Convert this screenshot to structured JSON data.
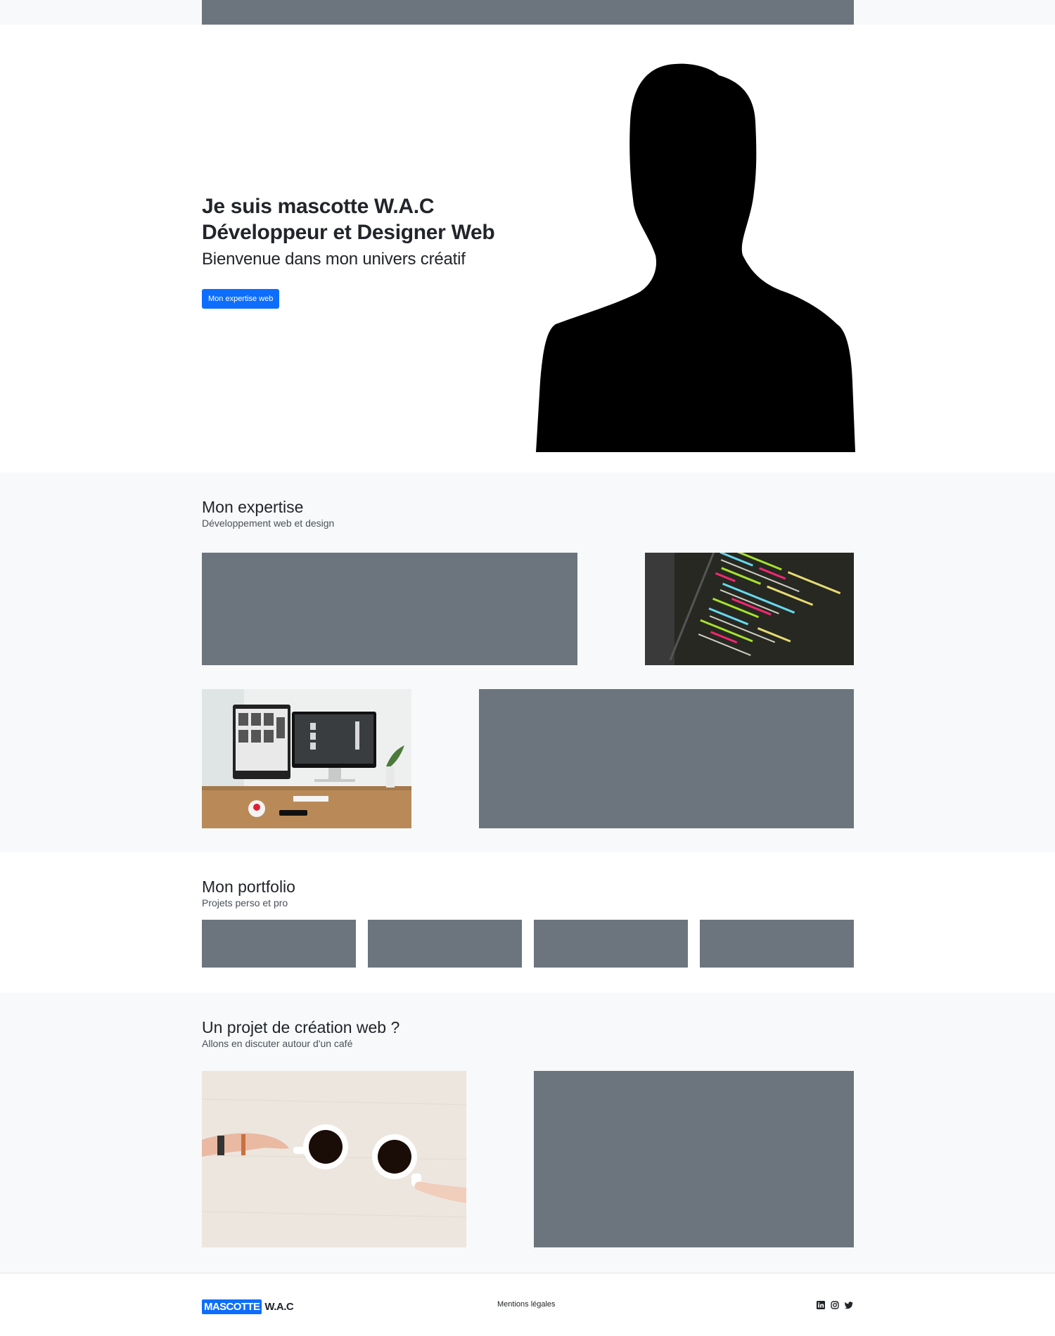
{
  "hero": {
    "title_line1": "Je suis mascotte W.A.C",
    "title_line2": "Développeur et Designer Web",
    "subtitle": "Bienvenue dans mon univers créatif",
    "cta_label": "Mon expertise web"
  },
  "expertise": {
    "title": "Mon expertise",
    "subtitle": "Développement web et design"
  },
  "portfolio": {
    "title": "Mon portfolio",
    "subtitle": "Projets perso et pro"
  },
  "contact": {
    "title": "Un projet de création web ?",
    "subtitle": "Allons en discuter autour d'un café"
  },
  "footer": {
    "logo_box": "MASCOTTE",
    "logo_text": "W.A.C",
    "legal_link": "Mentions légales",
    "social_icons": [
      "linkedin-icon",
      "instagram-icon",
      "twitter-icon"
    ]
  },
  "colors": {
    "primary": "#0d6efd",
    "placeholder": "#6c757d",
    "section_alt": "#f8f9fa"
  }
}
